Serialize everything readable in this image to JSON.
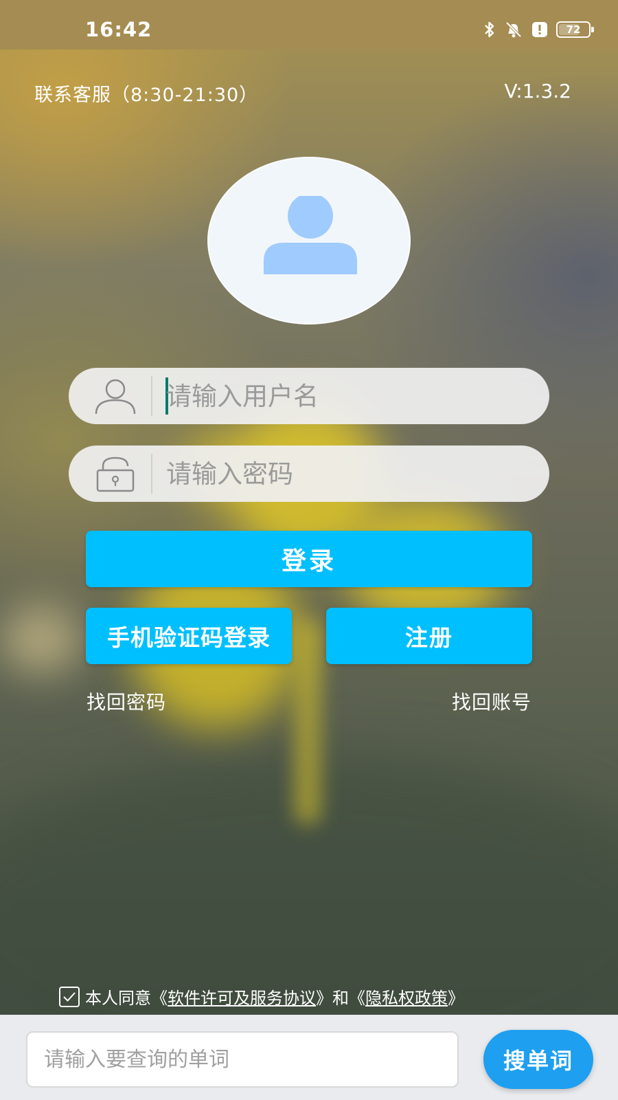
{
  "status_bar": {
    "time": "16:42",
    "battery": "72",
    "battery_level": 0.72,
    "icons": [
      "bluetooth-icon",
      "bell-muted-icon",
      "alert-icon",
      "battery-icon"
    ]
  },
  "header": {
    "contact": "联系客服（8:30-21:30）",
    "version": "V:1.3.2"
  },
  "avatar": {
    "icon": "user-avatar-icon"
  },
  "form": {
    "username_placeholder": "请输入用户名",
    "password_placeholder": "请输入密码",
    "username_icon": "user-icon",
    "password_icon": "lock-icon"
  },
  "buttons": {
    "login": "登录",
    "sms_login": "手机验证码登录",
    "register": "注册"
  },
  "links": {
    "find_password": "找回密码",
    "find_account": "找回账号"
  },
  "agreement": {
    "prefix": "本人同意",
    "open1": "《",
    "license": "软件许可及服务协议",
    "close1": "》",
    "and": "和",
    "open2": "《",
    "privacy": "隐私权政策",
    "close2": "》",
    "checked": true
  },
  "search": {
    "placeholder": "请输入要查询的单词",
    "button": "搜单词"
  },
  "colors": {
    "primary_button": "#00bfff",
    "search_button": "#1e9ff0",
    "status_bar": "#a58c52",
    "avatar_fill": "#9fcbff"
  }
}
